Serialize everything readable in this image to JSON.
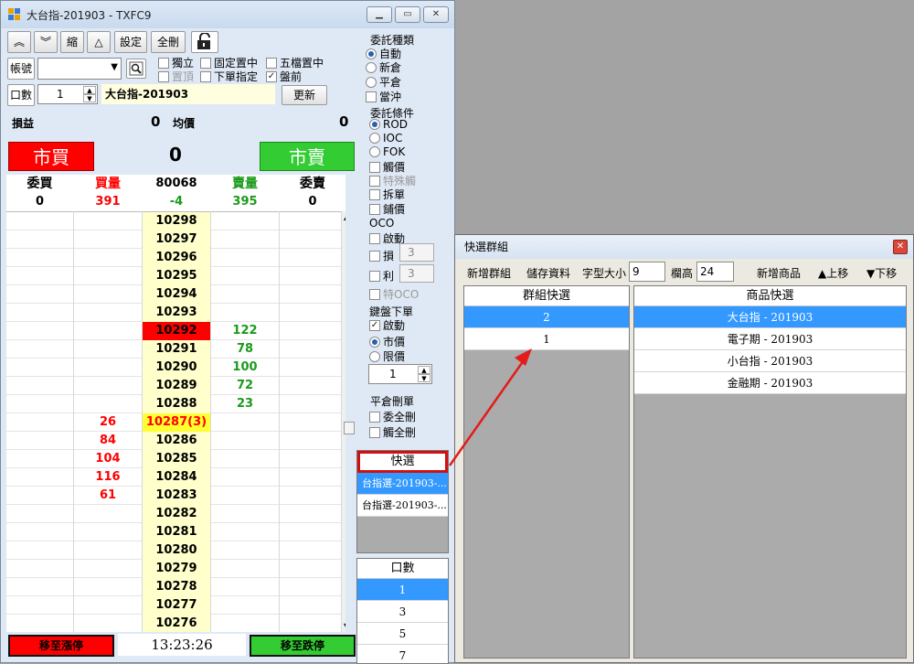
{
  "window": {
    "title": "大台指-201903 - TXFC9"
  },
  "toolbar": {
    "buttons": [
      "︽",
      "︾",
      "縮",
      "△",
      "設定",
      "全刪"
    ],
    "lock_icon": "unlock-icon"
  },
  "account": {
    "label": "帳號",
    "value": ""
  },
  "options": {
    "independent": "獨立",
    "fixed_center": "固定置中",
    "five_center": "五檔置中",
    "top_item": "置頂",
    "lower_specified": "下單指定",
    "pre_market": "盤前"
  },
  "qty": {
    "label": "口數",
    "value": "1",
    "product": "大台指-201903",
    "update": "更新"
  },
  "pnl": {
    "label": "損益",
    "value": "0",
    "avg_label": "均價",
    "avg_value": "0"
  },
  "trade": {
    "buy": "市買",
    "sell": "市賣",
    "center": "0"
  },
  "book": {
    "headers": [
      "委買",
      "買量",
      "80068",
      "賣量",
      "委賣"
    ],
    "summary": [
      "0",
      "391",
      "-4",
      "395",
      "0"
    ],
    "rows": [
      {
        "price": "10298",
        "buy": "",
        "sell": ""
      },
      {
        "price": "10297",
        "buy": "",
        "sell": ""
      },
      {
        "price": "10296",
        "buy": "",
        "sell": ""
      },
      {
        "price": "10295",
        "buy": "",
        "sell": ""
      },
      {
        "price": "10294",
        "buy": "",
        "sell": ""
      },
      {
        "price": "10293",
        "buy": "",
        "sell": ""
      },
      {
        "price": "10292",
        "buy": "",
        "sell": "122",
        "hl": "red"
      },
      {
        "price": "10291",
        "buy": "",
        "sell": "78"
      },
      {
        "price": "10290",
        "buy": "",
        "sell": "100"
      },
      {
        "price": "10289",
        "buy": "",
        "sell": "72"
      },
      {
        "price": "10288",
        "buy": "",
        "sell": "23"
      },
      {
        "price": "10287(3)",
        "buy": "26",
        "sell": "",
        "hl": "yellow"
      },
      {
        "price": "10286",
        "buy": "84",
        "sell": ""
      },
      {
        "price": "10285",
        "buy": "104",
        "sell": ""
      },
      {
        "price": "10284",
        "buy": "116",
        "sell": ""
      },
      {
        "price": "10283",
        "buy": "61",
        "sell": ""
      },
      {
        "price": "10282",
        "buy": "",
        "sell": ""
      },
      {
        "price": "10281",
        "buy": "",
        "sell": ""
      },
      {
        "price": "10280",
        "buy": "",
        "sell": ""
      },
      {
        "price": "10279",
        "buy": "",
        "sell": ""
      },
      {
        "price": "10278",
        "buy": "",
        "sell": ""
      },
      {
        "price": "10277",
        "buy": "",
        "sell": ""
      },
      {
        "price": "10276",
        "buy": "",
        "sell": ""
      }
    ]
  },
  "bottom": {
    "to_limit_up": "移至漲停",
    "time": "13:23:26",
    "to_limit_down": "移至跌停"
  },
  "side": {
    "order_type": {
      "title": "委託種類",
      "items": [
        "自動",
        "新倉",
        "平倉",
        "當沖"
      ]
    },
    "order_cond": {
      "title": "委託條件",
      "items": [
        "ROD",
        "IOC",
        "FOK",
        "觸價",
        "特殊觸",
        "拆單",
        "鋪價"
      ]
    },
    "oco": {
      "title": "OCO",
      "enable": "啟動",
      "loss": "損",
      "profit": "利",
      "loss_v": "3",
      "profit_v": "3",
      "special": "特OCO"
    },
    "keyboard": {
      "title": "鍵盤下單",
      "enable": "啟動",
      "market": "市價",
      "limit": "限價",
      "qty": "1"
    },
    "flat": {
      "title": "平倉刪單",
      "cancel_all_entrust": "委全刪",
      "cancel_all_touch": "觸全刪"
    },
    "quick": {
      "title": "快選",
      "items": [
        "台指選-201903-...",
        "台指選-201903-..."
      ]
    },
    "lots": {
      "title": "口數",
      "items": [
        "1",
        "3",
        "5",
        "7"
      ]
    }
  },
  "popup": {
    "title": "快選群組",
    "toolbar": {
      "new_group": "新增群組",
      "save": "儲存資料",
      "font_size_label": "字型大小",
      "font_size": "9",
      "row_height_label": "欄高",
      "row_height": "24",
      "new_product": "新增商品",
      "move_up": "▲上移",
      "move_down": "▼下移"
    },
    "groups": {
      "title": "群組快選",
      "items": [
        "2",
        "1"
      ]
    },
    "products": {
      "title": "商品快選",
      "items": [
        "大台指 - 201903",
        "電子期 - 201903",
        "小台指 - 201903",
        "金融期 - 201903"
      ]
    }
  },
  "colors": {
    "buy": "#ff0000",
    "sell": "#33cc33",
    "highlight_red": "#ff0000",
    "highlight_yellow": "#ffff33",
    "selection": "#3399ff"
  }
}
